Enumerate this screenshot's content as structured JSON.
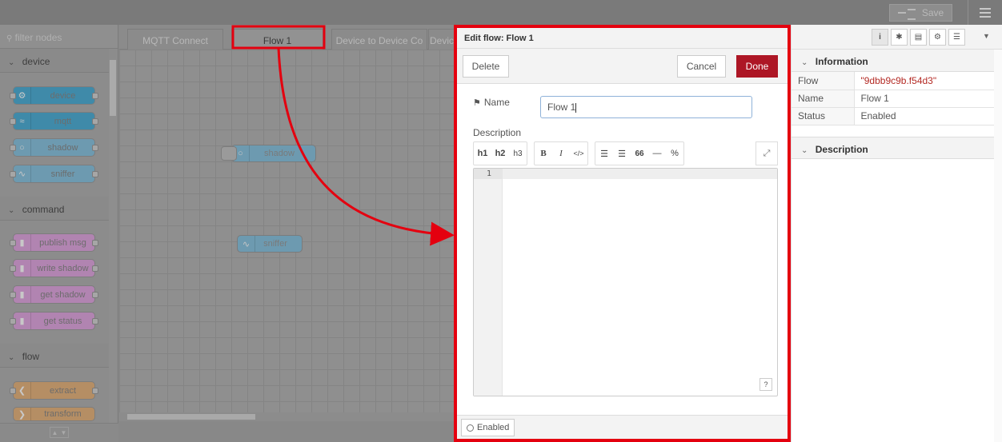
{
  "header": {
    "save_label": "Save"
  },
  "palette": {
    "filter_placeholder": "filter nodes",
    "categories": [
      {
        "label": "device",
        "nodes": [
          "device",
          "mqtt",
          "shadow",
          "sniffer"
        ]
      },
      {
        "label": "command",
        "nodes": [
          "publish msg",
          "write shadow",
          "get shadow",
          "get status"
        ]
      },
      {
        "label": "flow",
        "nodes": [
          "extract",
          "transform"
        ]
      }
    ]
  },
  "workspace": {
    "tabs": [
      "MQTT Connect",
      "Flow 1",
      "Device to Device Co",
      "Devic"
    ],
    "canvas_nodes": [
      "shadow",
      "sniffer"
    ]
  },
  "tray": {
    "title": "Edit flow: Flow 1",
    "delete_label": "Delete",
    "cancel_label": "Cancel",
    "done_label": "Done",
    "name_label": "Name",
    "name_value": "Flow 1",
    "description_label": "Description",
    "md_buttons": {
      "h1": "h1",
      "h2": "h2",
      "h3": "h3",
      "bold": "B",
      "italic": "I",
      "code": "</>",
      "ol": "☰",
      "ul": "☰",
      "quote": "66",
      "hr": "—",
      "link": "%"
    },
    "line_number": "1",
    "help_label": "?",
    "enabled_label": "Enabled"
  },
  "sidebar": {
    "information_label": "Information",
    "description_label": "Description",
    "rows": [
      {
        "key": "Flow",
        "value": "\"9dbb9c9b.f54d3\""
      },
      {
        "key": "Name",
        "value": "Flow 1"
      },
      {
        "key": "Status",
        "value": "Enabled"
      }
    ]
  },
  "colors": {
    "accent_red": "#e4000f",
    "done_button": "#ad1625"
  }
}
